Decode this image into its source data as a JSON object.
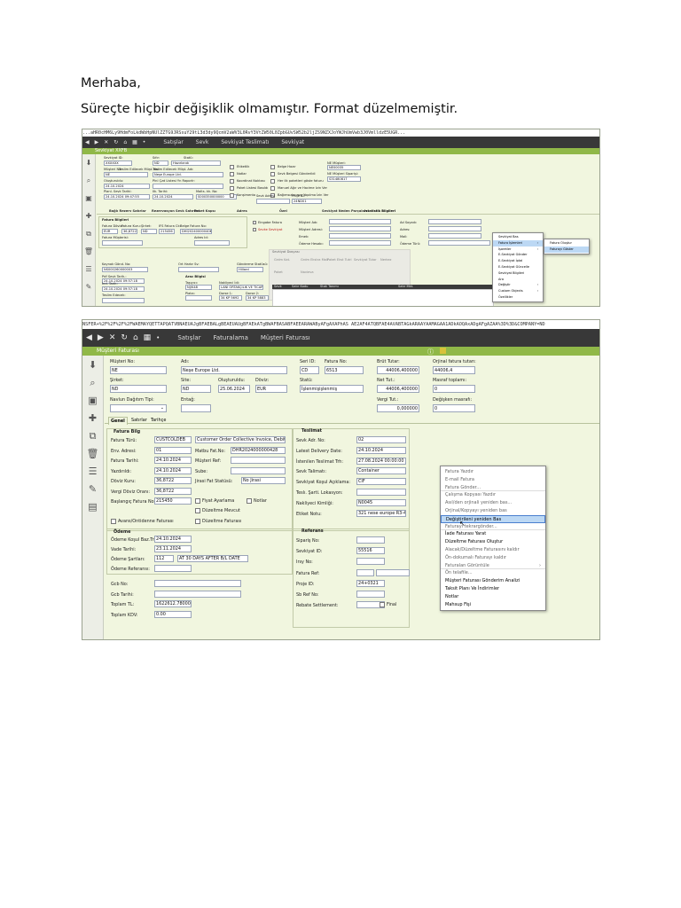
{
  "message": {
    "greeting": "Merhaba,",
    "body": "Süreçte hiçbir değişiklik olmamıştır. Format düzelmemiştir."
  },
  "colors": {
    "nav_bg": "#383838",
    "title_bar": "#90b848",
    "form_bg": "#f1f6df",
    "menu_highlight": "#bcd8f4"
  },
  "s1": {
    "url": "...aHR0cHM6Ly9HdmFoLkdWbHpNUlZZTG9JRSsuY29tL3d3dy9QcmV2aWV3L0RvY3VtZW50L0ZpbGUvSW52b2ljZS9NZXJoYWJhUmVwb3J0VmlldzE5UGR...",
    "menu": [
      "Satışlar",
      "Sevk",
      "Sevkiyat Teslimatı",
      "Sevkiyat"
    ],
    "title": "Sevkiyat XXFB",
    "labels": [
      "Sevkiyat ID:",
      "Sıfır:",
      "Statü:",
      "Müşteri No:",
      "Teslim Edilecek Müşt. No:",
      "Teslim Edilecek Müşt. Adı:",
      "Oluşturuldu:",
      "Plnl Çzd Listesi Yn Raporlr:",
      "Planl. Sevk Tarihi:",
      "Ilk. Tarihi:",
      "Malts. kk. No:",
      "Sevk Adresi"
    ],
    "values": {
      "id": "XXXXXX",
      "sifir": "ND",
      "statu": "Hazırlandı",
      "musteri": "NE",
      "teslim_adi": "Neşe Europe Ltd.",
      "olusturuldu": "24.10.2024",
      "planl": "24.10.2024 09:47:55",
      "ilk": "24.10.2024",
      "malts": "S000350000000",
      "proje": "24ND01"
    },
    "checks": [
      "Etiketlik",
      "Notlar",
      "Koordinat Noktası",
      "Paket Listesi Basıldı",
      "Konşimento"
    ],
    "checks2": [
      "Belge Hazır",
      "Sevk Belgesi Gönderildi",
      "Her ilk paketleri göste faturu",
      "Manuel Ağır ve Hacime Izin Ver",
      "Bağımsızlanmış Yapılma İzin Ver"
    ],
    "right_labels": [
      "NE Müşteri:",
      "NE Müşteri Siparişi:",
      "Malzeme",
      "Proje ID:"
    ],
    "right_values": [
      "NE00035",
      "S31480817",
      "24ND01"
    ],
    "tabs": [
      "Bağlı Rezerv Satırlar",
      "Rezervasyon Sevk Satırları",
      "Paket Kapsı",
      "Adres",
      "Özel",
      "Sevkiyat Neden Parçaları",
      "Istatistik Bilgileri"
    ],
    "fatura_head": "Fatura Bilgileri",
    "fatura_labels": [
      "Fatura Dövizi:",
      "Fatura Kuru:",
      "Şirket:",
      "IFS Fatura Ck:",
      "Belge Fatura No:",
      "Fatura Müşterisi:",
      "Adres Id:"
    ],
    "fatura_values": [
      "EUR",
      "36,8722",
      "ND",
      "215456",
      "DHI20240000040K"
    ],
    "etiket": [
      "Eingabe Fatura",
      "Sevke Sevkiyat"
    ],
    "mid_labels": [
      "Müşteri Adı:",
      "Müşteri Adresi:",
      "Emek:",
      "Ödeme Hesabı:"
    ],
    "right2_labels": [
      "Ad Soyadı:",
      "Adres:",
      "Mail:",
      "Ödeme Türü:"
    ],
    "grey_tab": "Sevkiyat Dosyası",
    "grey_cols": [
      "Grdm Kat.",
      "Grdm Ekstra Mali",
      "Paket Ekst Tutrl",
      "Sevkiyat Tutar",
      "Nerkez"
    ],
    "grey_cols2": [
      "Paket",
      "Navieva"
    ],
    "bottom_labels": [
      "Kaynak Gönd. No:",
      "Ort Harbr Sv:",
      "Gönderme Statüsü:",
      "Pdf Sevk Tarih.:",
      "Arac Bilgisi",
      "Taşıyıcı:",
      "Nakliyeci İdi:",
      "İnd. Tarih:",
      "Plaka:",
      "Dorse 1:",
      "Dorse 2:",
      "Teslim Edecek:"
    ],
    "bottom_values": [
      "NS000260000003",
      "Hillard",
      "24.10.2024 09:57:18",
      "24.10.2024 09:57:18",
      "NJ/K48",
      "LANI ORTAKÇİLIK VE TİCARET AŞ",
      "34 KP 5692",
      "34 KP 5883"
    ],
    "table_cols": [
      "Sevk",
      "Satır Kodu",
      "Stok Tanımı",
      "Satır Mkt."
    ],
    "context_menu": [
      {
        "label": "Sevkiyat Bas",
        "sub": false
      },
      {
        "label": "Fatura İşlemleri",
        "sub": true,
        "hl": true
      },
      {
        "label": "İşaretler",
        "sub": true
      },
      {
        "label": "E-Sevkiyat Gönder",
        "sub": false
      },
      {
        "label": "E-Sevkiyat İptal",
        "sub": false
      },
      {
        "label": "E-Sevkiyat Güncelle",
        "sub": false
      },
      {
        "label": "Sevkiyat Bilgileri",
        "sub": false
      },
      {
        "label": "Ara",
        "sub": false
      },
      {
        "label": "Değiştir",
        "sub": true
      },
      {
        "label": "Custom Objects",
        "sub": true
      },
      {
        "label": "Özellikler",
        "sub": false
      }
    ],
    "submenu": [
      "Fatura Oluştur",
      "Faturayı Göster"
    ]
  },
  "s2": {
    "url": "NSFER+%2F%2F%2F%2FWAEMAYQETTAPQATVBNAEUAJgBFAEBALgBEAEUAUgBFAEkATgBWAFBASABFAEEARAWAByAFgAXAPhAS AE2AF4ATQBFAE4AVABTAGkARAAYAAMAGAA1ADkAOQAxADgAFgAZAA%3D%3D&COMPANY=ND",
    "menu": [
      "Satışlar",
      "Faturalama",
      "Müşteri Faturası"
    ],
    "title": "Müşteri Faturası",
    "header": {
      "musteri_no_l": "Müşteri No:",
      "musteri_no": "NE",
      "adi_l": "Adı:",
      "adi": "Neşe Europe Ltd.",
      "seri_l": "Seri ID:",
      "seri": "CD",
      "fatura_no_l": "Fatura No:",
      "fatura_no": "6513",
      "brut_l": "Brüt Tutar:",
      "brut": "44006,400000",
      "orijinal_l": "Orjinal fatura tutarı:",
      "orijinal": "44006,4",
      "sirket_l": "Şirket:",
      "sirket": "ND",
      "site_l": "Site:",
      "site": "ND",
      "olus_l": "Oluşturuldu:",
      "olus": "25.06.2024",
      "doviz_l": "Döviz:",
      "doviz": "EUR",
      "statu_l": "Statü:",
      "statu": "İşlenmişişlenmiş",
      "net_l": "Net Tut.:",
      "net": "44006,400000",
      "masraf_l": "Masraf toplamı:",
      "masraf": "0",
      "navlun_l": "Navlun Dağıtım Tipi:",
      "entagl_l": "Entağ:",
      "vergi_l": "Vergi Tut.:",
      "vergi": "0,000000",
      "degis_l": "Değişken masrafı:",
      "degis": "0"
    },
    "tabs": [
      "Genel",
      "Satırlar",
      "Tarihçe"
    ],
    "fatura_bilg": {
      "head": "Fatura Bilg",
      "rows": [
        {
          "l": "Fatura Türü:",
          "v": "CUSTCOLDEB",
          "l2": "",
          "v2": "Customer Order Collective Invoice, Debit"
        },
        {
          "l": "Env. Adresi:",
          "v": "01",
          "l2": "Matbu Fat.No:",
          "v2": "DHR2024000000428"
        },
        {
          "l": "Fatura Tarihi:",
          "v": "24.10.2024",
          "l2": "Müşteri Ref:",
          "v2": ""
        },
        {
          "l": "Yazdırıldı:",
          "v": "24.10.2024",
          "l2": "Sube:",
          "v2": ""
        },
        {
          "l": "Döviz Kuru:",
          "v": "36,8722",
          "l2": "Jirasi Fat Statüsü:",
          "v2": "No Jirasi"
        },
        {
          "l": "Vergi Döviz Oranı:",
          "v": "36,8722",
          "l2": "",
          "v2": ""
        },
        {
          "l": "Başlangıç Fatura No:",
          "v": "215450",
          "l2": "",
          "v2": ""
        }
      ],
      "checks": [
        "Fiyat Ayarlama",
        "Notlar",
        "Düzeltme Mevcut",
        "Avans/Ontidenne Faturası",
        "Düzeltme Faturası"
      ]
    },
    "teslimat": {
      "head": "Teslimat",
      "rows": [
        {
          "l": "Sevk Adr. No:",
          "v": "02"
        },
        {
          "l": "Latest Delivery Date:",
          "v": "24.10.2024"
        },
        {
          "l": "İstenilen Teslimat Trh:",
          "v": "27.08.2024 00:00:00"
        },
        {
          "l": "Sevk Talimatı:",
          "v": "Container"
        },
        {
          "l": "Sevkiyat Koşul Açıklama:",
          "v": "CIF"
        },
        {
          "l": "Teslı. Şarti. Lokasyon:",
          "v": ""
        },
        {
          "l": "Nakliyeci Kimliği:",
          "v": "N0045"
        },
        {
          "l": "Etiket Notu:",
          "v": "321 nese europe R3-42"
        }
      ]
    },
    "odeme": {
      "head": "Ödeme",
      "rows": [
        {
          "l": "Ödeme Koşul Baz.Trh.:",
          "v": "24.10.2024"
        },
        {
          "l": "Vade Tarihi:",
          "v": "23.11.2024"
        },
        {
          "l": "Ödeme Şartları:",
          "v": "112",
          "v2": "AT 30 DAYS AFTER B/L DATE"
        },
        {
          "l": "Ödeme Referansı:",
          "v": ""
        }
      ]
    },
    "referans": {
      "head": "Referans",
      "rows": [
        {
          "l": "Sipariş No:",
          "v": ""
        },
        {
          "l": "Sevkiyat ID:",
          "v": "55516"
        },
        {
          "l": "Irsy No:",
          "v": ""
        },
        {
          "l": "Fatura Ref:",
          "v": ""
        },
        {
          "l": "Proje ID:",
          "v": "24+0321"
        },
        {
          "l": "Sb Ref No:",
          "v": ""
        },
        {
          "l": "Rebate Settlement:",
          "v": ""
        }
      ],
      "final": "Final"
    },
    "bottom": [
      {
        "l": "Gcb No:",
        "v": ""
      },
      {
        "l": "Gcb Tarihi:",
        "v": ""
      },
      {
        "l": "Toplam TL:",
        "v": "1622612.780000"
      },
      {
        "l": "Toplam KDV:",
        "v": "0.00"
      }
    ],
    "context_menu": [
      {
        "label": "Fatura Yazdır",
        "dim": true
      },
      {
        "label": "E-mail Fatura",
        "dim": true
      },
      {
        "label": "Fatura Gönder...",
        "dim": true,
        "sep": true
      },
      {
        "label": "Çalışma Kopyası Yazdır",
        "dim": true
      },
      {
        "label": "Asıl/den orjinali yeniden bas...",
        "dim": true
      },
      {
        "label": "Orjinal/Kopyayı yeniden bas",
        "dim": true
      },
      {
        "label": "Değiştirileni yeniden Bas",
        "dim": false,
        "hl": true
      },
      {
        "label": "Faturayı tekrargönder...",
        "dim": true,
        "sep": true
      },
      {
        "label": "İade Faturası Yarat",
        "dim": false
      },
      {
        "label": "Düzeltme Faturası Oluştur",
        "dim": false
      },
      {
        "label": "Alacak/Düzeltme Faturasını kaldır",
        "dim": true
      },
      {
        "label": "Ön-dokumalı Faturayı kaldır",
        "dim": true
      },
      {
        "label": "Faturalan Görüntüle",
        "dim": true,
        "sub": true,
        "sep": true
      },
      {
        "label": "Ön telafile...",
        "dim": true
      },
      {
        "label": "Müşteri Faturası Gönderim Analizi",
        "dim": false
      },
      {
        "label": "Taksit Planı Ve İndirimler",
        "dim": false
      },
      {
        "label": "Notlar",
        "dim": false
      },
      {
        "label": "Mahsup Fişi",
        "dim": false
      }
    ]
  }
}
